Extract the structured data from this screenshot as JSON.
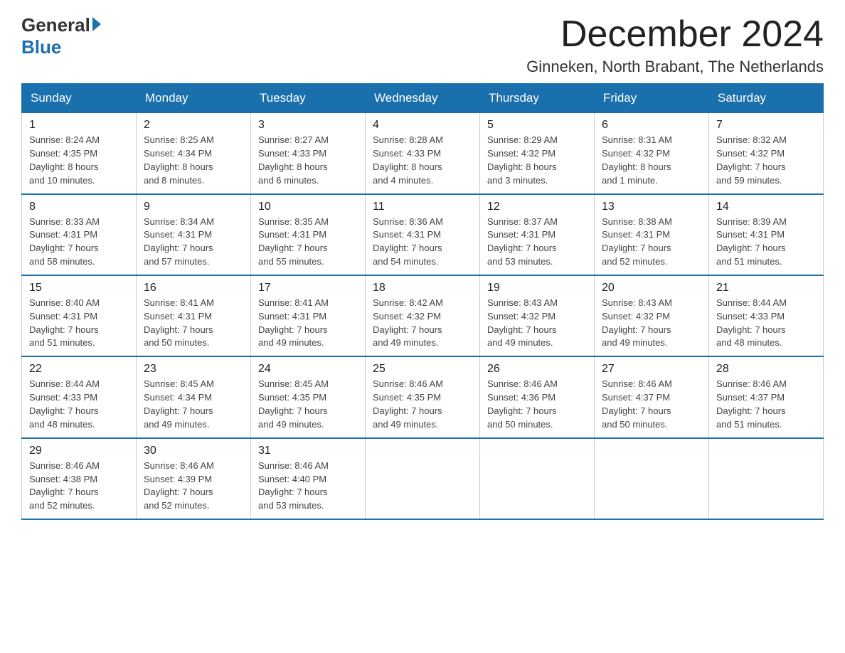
{
  "header": {
    "logo_general": "General",
    "logo_blue": "Blue",
    "title": "December 2024",
    "subtitle": "Ginneken, North Brabant, The Netherlands"
  },
  "columns": [
    "Sunday",
    "Monday",
    "Tuesday",
    "Wednesday",
    "Thursday",
    "Friday",
    "Saturday"
  ],
  "weeks": [
    [
      {
        "day": "1",
        "info": "Sunrise: 8:24 AM\nSunset: 4:35 PM\nDaylight: 8 hours\nand 10 minutes."
      },
      {
        "day": "2",
        "info": "Sunrise: 8:25 AM\nSunset: 4:34 PM\nDaylight: 8 hours\nand 8 minutes."
      },
      {
        "day": "3",
        "info": "Sunrise: 8:27 AM\nSunset: 4:33 PM\nDaylight: 8 hours\nand 6 minutes."
      },
      {
        "day": "4",
        "info": "Sunrise: 8:28 AM\nSunset: 4:33 PM\nDaylight: 8 hours\nand 4 minutes."
      },
      {
        "day": "5",
        "info": "Sunrise: 8:29 AM\nSunset: 4:32 PM\nDaylight: 8 hours\nand 3 minutes."
      },
      {
        "day": "6",
        "info": "Sunrise: 8:31 AM\nSunset: 4:32 PM\nDaylight: 8 hours\nand 1 minute."
      },
      {
        "day": "7",
        "info": "Sunrise: 8:32 AM\nSunset: 4:32 PM\nDaylight: 7 hours\nand 59 minutes."
      }
    ],
    [
      {
        "day": "8",
        "info": "Sunrise: 8:33 AM\nSunset: 4:31 PM\nDaylight: 7 hours\nand 58 minutes."
      },
      {
        "day": "9",
        "info": "Sunrise: 8:34 AM\nSunset: 4:31 PM\nDaylight: 7 hours\nand 57 minutes."
      },
      {
        "day": "10",
        "info": "Sunrise: 8:35 AM\nSunset: 4:31 PM\nDaylight: 7 hours\nand 55 minutes."
      },
      {
        "day": "11",
        "info": "Sunrise: 8:36 AM\nSunset: 4:31 PM\nDaylight: 7 hours\nand 54 minutes."
      },
      {
        "day": "12",
        "info": "Sunrise: 8:37 AM\nSunset: 4:31 PM\nDaylight: 7 hours\nand 53 minutes."
      },
      {
        "day": "13",
        "info": "Sunrise: 8:38 AM\nSunset: 4:31 PM\nDaylight: 7 hours\nand 52 minutes."
      },
      {
        "day": "14",
        "info": "Sunrise: 8:39 AM\nSunset: 4:31 PM\nDaylight: 7 hours\nand 51 minutes."
      }
    ],
    [
      {
        "day": "15",
        "info": "Sunrise: 8:40 AM\nSunset: 4:31 PM\nDaylight: 7 hours\nand 51 minutes."
      },
      {
        "day": "16",
        "info": "Sunrise: 8:41 AM\nSunset: 4:31 PM\nDaylight: 7 hours\nand 50 minutes."
      },
      {
        "day": "17",
        "info": "Sunrise: 8:41 AM\nSunset: 4:31 PM\nDaylight: 7 hours\nand 49 minutes."
      },
      {
        "day": "18",
        "info": "Sunrise: 8:42 AM\nSunset: 4:32 PM\nDaylight: 7 hours\nand 49 minutes."
      },
      {
        "day": "19",
        "info": "Sunrise: 8:43 AM\nSunset: 4:32 PM\nDaylight: 7 hours\nand 49 minutes."
      },
      {
        "day": "20",
        "info": "Sunrise: 8:43 AM\nSunset: 4:32 PM\nDaylight: 7 hours\nand 49 minutes."
      },
      {
        "day": "21",
        "info": "Sunrise: 8:44 AM\nSunset: 4:33 PM\nDaylight: 7 hours\nand 48 minutes."
      }
    ],
    [
      {
        "day": "22",
        "info": "Sunrise: 8:44 AM\nSunset: 4:33 PM\nDaylight: 7 hours\nand 48 minutes."
      },
      {
        "day": "23",
        "info": "Sunrise: 8:45 AM\nSunset: 4:34 PM\nDaylight: 7 hours\nand 49 minutes."
      },
      {
        "day": "24",
        "info": "Sunrise: 8:45 AM\nSunset: 4:35 PM\nDaylight: 7 hours\nand 49 minutes."
      },
      {
        "day": "25",
        "info": "Sunrise: 8:46 AM\nSunset: 4:35 PM\nDaylight: 7 hours\nand 49 minutes."
      },
      {
        "day": "26",
        "info": "Sunrise: 8:46 AM\nSunset: 4:36 PM\nDaylight: 7 hours\nand 50 minutes."
      },
      {
        "day": "27",
        "info": "Sunrise: 8:46 AM\nSunset: 4:37 PM\nDaylight: 7 hours\nand 50 minutes."
      },
      {
        "day": "28",
        "info": "Sunrise: 8:46 AM\nSunset: 4:37 PM\nDaylight: 7 hours\nand 51 minutes."
      }
    ],
    [
      {
        "day": "29",
        "info": "Sunrise: 8:46 AM\nSunset: 4:38 PM\nDaylight: 7 hours\nand 52 minutes."
      },
      {
        "day": "30",
        "info": "Sunrise: 8:46 AM\nSunset: 4:39 PM\nDaylight: 7 hours\nand 52 minutes."
      },
      {
        "day": "31",
        "info": "Sunrise: 8:46 AM\nSunset: 4:40 PM\nDaylight: 7 hours\nand 53 minutes."
      },
      {
        "day": "",
        "info": ""
      },
      {
        "day": "",
        "info": ""
      },
      {
        "day": "",
        "info": ""
      },
      {
        "day": "",
        "info": ""
      }
    ]
  ]
}
